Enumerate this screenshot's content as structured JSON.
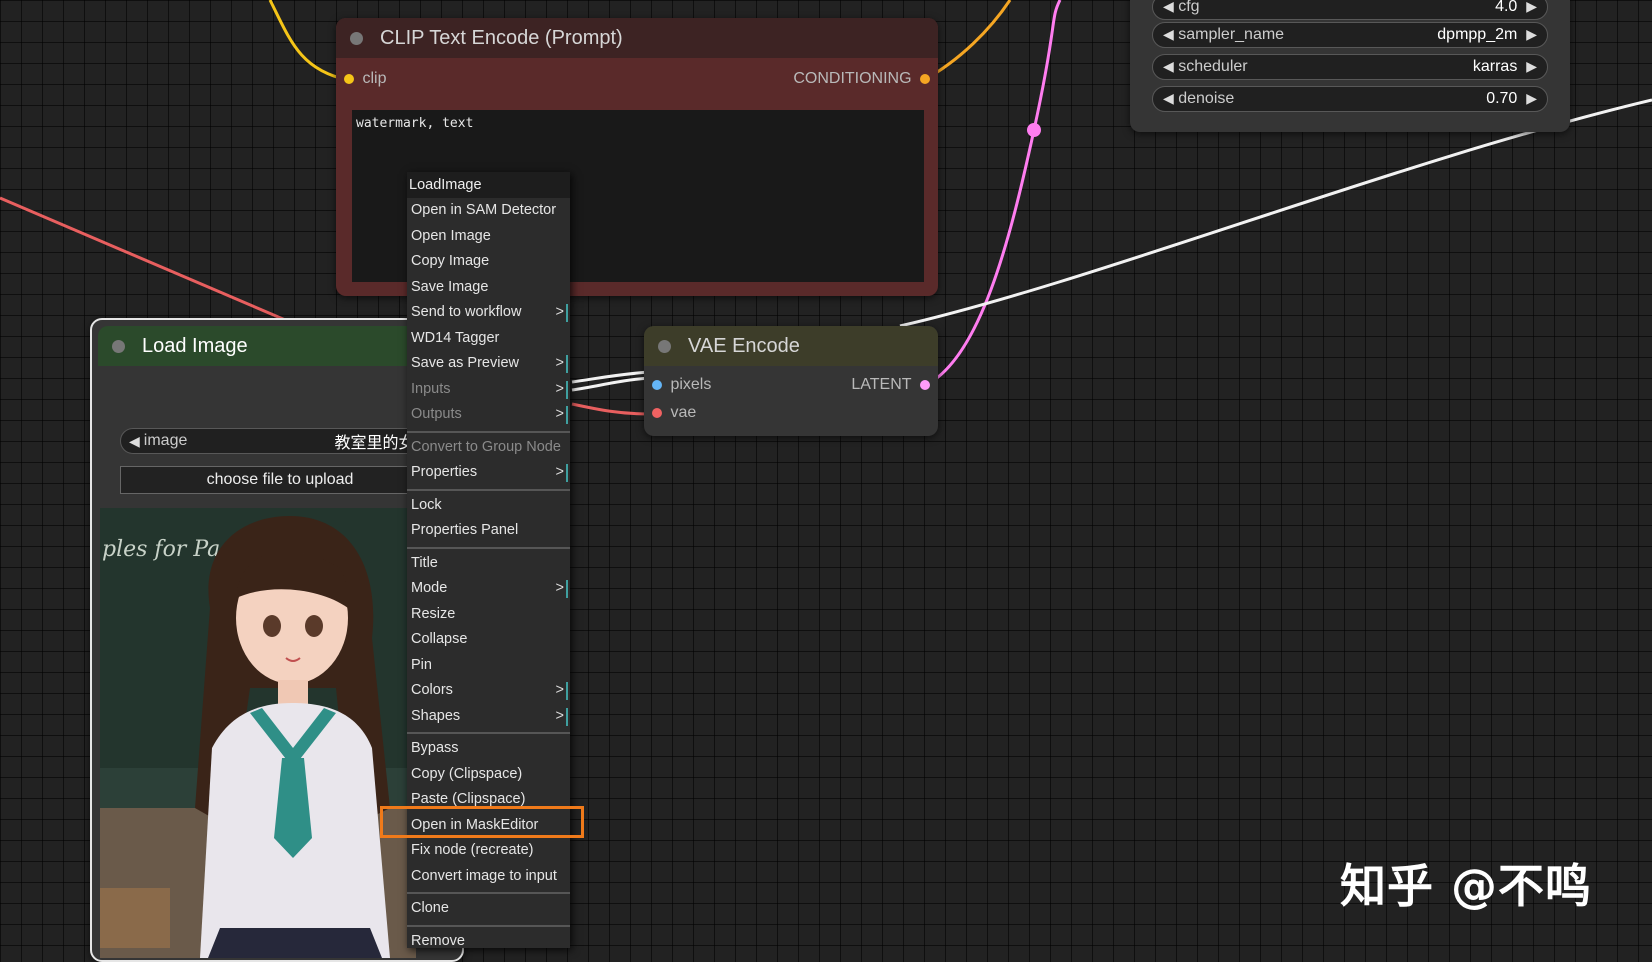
{
  "clip_node": {
    "title": "CLIP Text Encode (Prompt)",
    "input_label": "clip",
    "output_label": "CONDITIONING",
    "text_value": "watermark, text"
  },
  "load_image_node": {
    "title": "Load Image",
    "image_widget_label": "image",
    "image_widget_value": "教室里的女孩.",
    "upload_button_label": "choose file to upload",
    "preview_text": "ples for Pa"
  },
  "vae_node": {
    "title": "VAE Encode",
    "input_pixels_label": "pixels",
    "input_vae_label": "vae",
    "output_label": "LATENT"
  },
  "ksampler_node": {
    "widgets": [
      {
        "label": "cfg",
        "value": "4.0"
      },
      {
        "label": "sampler_name",
        "value": "dpmpp_2m"
      },
      {
        "label": "scheduler",
        "value": "karras"
      },
      {
        "label": "denoise",
        "value": "0.70"
      }
    ]
  },
  "context_menu": {
    "title": "LoadImage",
    "items": [
      {
        "label": "Open in SAM Detector",
        "sub": false,
        "disabled": false
      },
      {
        "label": "Open Image",
        "sub": false,
        "disabled": false
      },
      {
        "label": "Copy Image",
        "sub": false,
        "disabled": false
      },
      {
        "label": "Save Image",
        "sub": false,
        "disabled": false
      },
      {
        "label": "Send to workflow",
        "sub": true,
        "disabled": false
      },
      {
        "label": "WD14 Tagger",
        "sub": false,
        "disabled": false
      },
      {
        "label": "Save as Preview",
        "sub": true,
        "disabled": false
      },
      {
        "label": "Inputs",
        "sub": true,
        "disabled": true
      },
      {
        "label": "Outputs",
        "sub": true,
        "disabled": true
      },
      {
        "label": "Convert to Group Node",
        "sub": false,
        "disabled": true
      },
      {
        "label": "Properties",
        "sub": true,
        "disabled": false
      },
      {
        "label": "Lock",
        "sub": false,
        "disabled": false
      },
      {
        "label": "Properties Panel",
        "sub": false,
        "disabled": false
      },
      {
        "label": "Title",
        "sub": false,
        "disabled": false
      },
      {
        "label": "Mode",
        "sub": true,
        "disabled": false
      },
      {
        "label": "Resize",
        "sub": false,
        "disabled": false
      },
      {
        "label": "Collapse",
        "sub": false,
        "disabled": false
      },
      {
        "label": "Pin",
        "sub": false,
        "disabled": false
      },
      {
        "label": "Colors",
        "sub": true,
        "disabled": false
      },
      {
        "label": "Shapes",
        "sub": true,
        "disabled": false
      },
      {
        "label": "Bypass",
        "sub": false,
        "disabled": false
      },
      {
        "label": "Copy (Clipspace)",
        "sub": false,
        "disabled": false
      },
      {
        "label": "Paste (Clipspace)",
        "sub": false,
        "disabled": false
      },
      {
        "label": "Open in MaskEditor",
        "sub": false,
        "disabled": false
      },
      {
        "label": "Fix node (recreate)",
        "sub": false,
        "disabled": false
      },
      {
        "label": "Convert image to input",
        "sub": false,
        "disabled": false
      },
      {
        "label": "Clone",
        "sub": false,
        "disabled": false
      },
      {
        "label": "Remove",
        "sub": false,
        "disabled": false
      }
    ],
    "submenu_glyph": ">"
  },
  "watermark": "知乎 @不鸣",
  "colors": {
    "clip_slot": "#f5c518",
    "conditioning_slot": "#f5a623",
    "pixels_slot": "#64b5f6",
    "vae_slot": "#f06262",
    "latent_slot": "#ff9cf9",
    "highlight": "#f07a1a"
  }
}
